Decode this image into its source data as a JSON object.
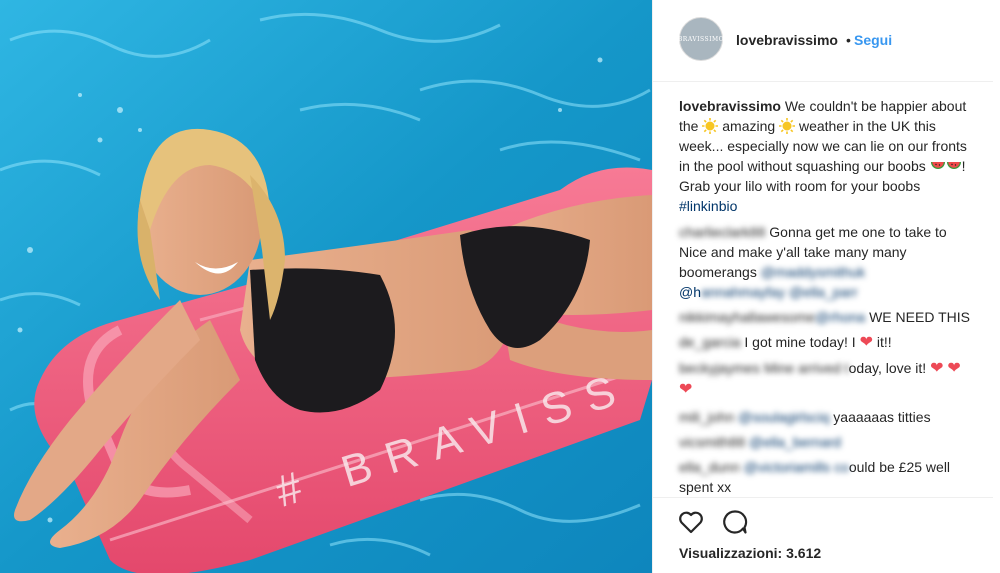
{
  "post": {
    "author": "lovebravissimo",
    "separator": "•",
    "follow_label": "Segui",
    "avatar_mark": "BRAVISSIMO",
    "lilo_print": "# BRAVISS"
  },
  "caption": {
    "user": "lovebravissimo",
    "part1": " We couldn't be happier about the ",
    "part2": " amazing ",
    "part3": " weather in the UK this week... especially now we can lie on our fronts in the pool without squashing our boobs ",
    "part4": "! Grab your lilo with room for your boobs ",
    "hashtag": "#linkinbio"
  },
  "comments": [
    {
      "user_blur": "charlieclark88",
      "text": " Gonna get me one to take to Nice and make y'all take many many boomerangs ",
      "mention_blur": "@maddysmithuk",
      "mention2_visible": "@h",
      "mention2_blur": "annahmayfay @ella_parr"
    },
    {
      "user_blur": "nikkimayhallawesome",
      "mention_blur": "@rhona",
      "text": " WE NEED THIS"
    },
    {
      "user_blur": "de_garcia",
      "text": " I got mine today! I ",
      "text2": " it!!"
    },
    {
      "user_blur": "beckyjaymes",
      "mid_blur": "Mine arrived t",
      "text": "oday, love it! "
    },
    {
      "user_blur": "mili_john",
      "mention_blur": "@soulagirlsciq",
      "text": " yaaaaaas titties"
    },
    {
      "user_blur": "vicsmith88",
      "mention_blur": "@ella_bernard"
    },
    {
      "user_blur": "ella_dunn",
      "mention_blur": "@victoriamills co",
      "text": "ould be £25 well spent xx"
    }
  ],
  "stats": {
    "views_label": "Visualizzazioni:",
    "views_count": "3.612"
  },
  "icons": {
    "like": "heart-outline-icon",
    "comment": "speech-bubble-icon"
  },
  "colors": {
    "link": "#3897f0",
    "hashtag": "#003569",
    "heart": "#ed4956",
    "pool": "#1aa6d6",
    "lilo": "#f2607f"
  }
}
